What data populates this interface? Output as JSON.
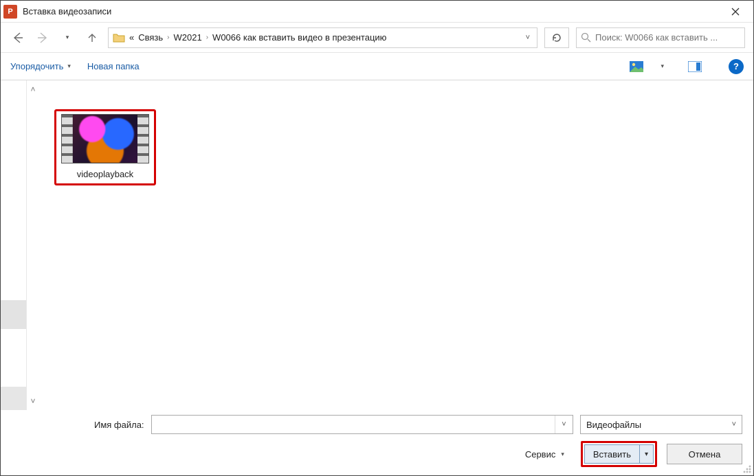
{
  "title": "Вставка видеозаписи",
  "app_icon_letter": "P",
  "breadcrumb": {
    "prefix": "«",
    "items": [
      "Связь",
      "W2021",
      "W0066 как вставить видео в презентацию"
    ]
  },
  "search": {
    "placeholder": "Поиск: W0066 как вставить ..."
  },
  "toolbar": {
    "organize_label": "Упорядочить",
    "new_folder_label": "Новая папка"
  },
  "files": [
    {
      "name": "videoplayback"
    }
  ],
  "footer": {
    "filename_label": "Имя файла:",
    "filename_value": "",
    "filetype_label": "Видеофайлы",
    "tools_label": "Сервис",
    "insert_label": "Вставить",
    "cancel_label": "Отмена"
  }
}
